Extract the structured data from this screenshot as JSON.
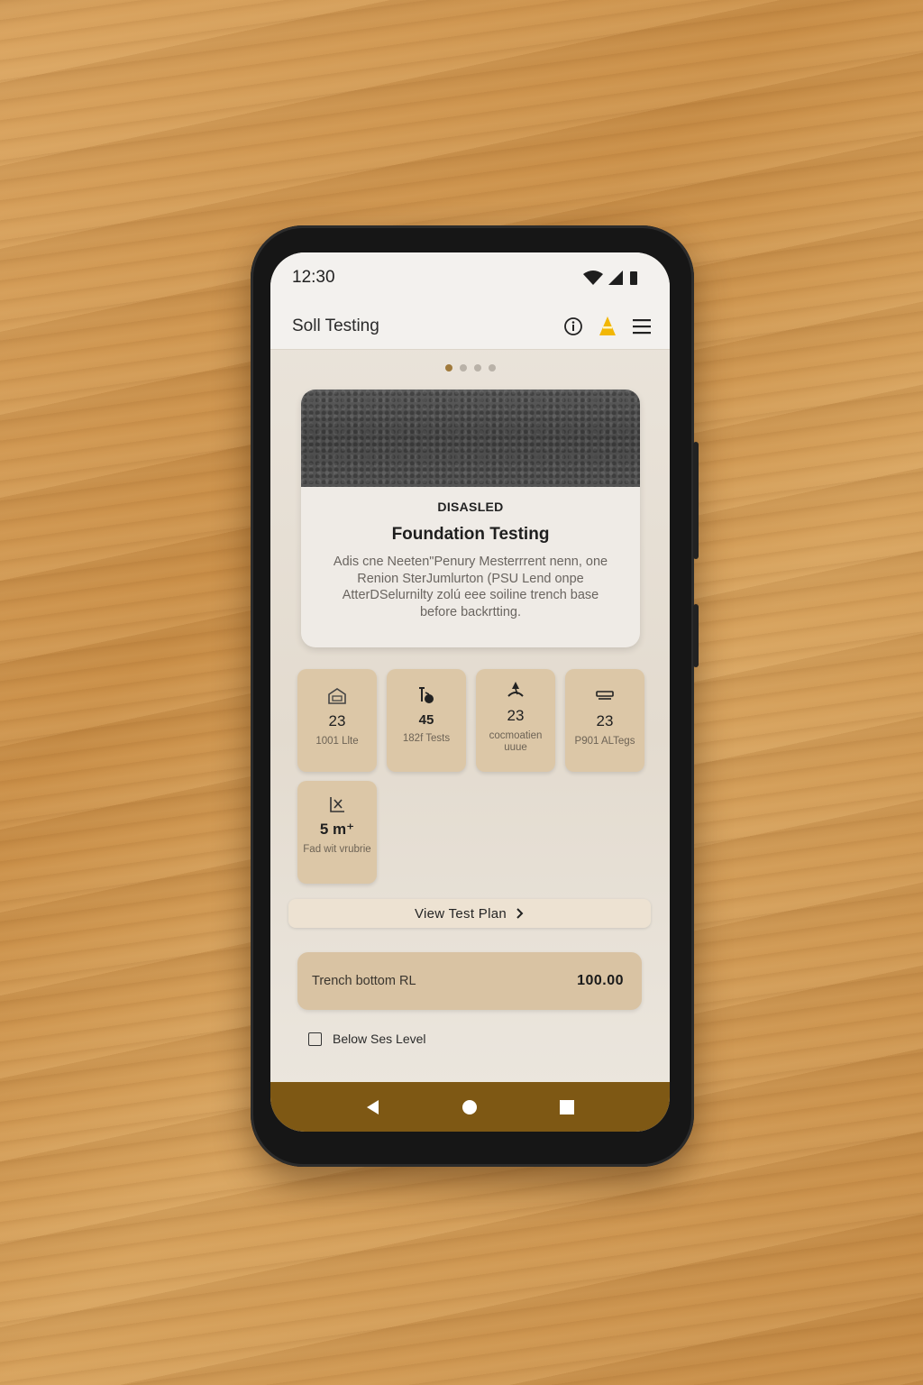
{
  "status_bar": {
    "time": "12:30"
  },
  "app_bar": {
    "title": "Soll Testing"
  },
  "carousel": {
    "page_count": 4,
    "active_index": 0
  },
  "hero": {
    "badge": "DISASLED",
    "title": "Foundation Testing",
    "description": "Adis cne Neeten\"Penury Mesterrrent nenn, one Renion  SterJumlurton (PSU Lend onpe AtterDSelurnilty zolú eee soiline trench base before backrtting."
  },
  "stats": [
    {
      "icon": "building-icon",
      "value": "23",
      "label": "1001 Llte"
    },
    {
      "icon": "probe-icon",
      "value": "45",
      "label": "182f Tests"
    },
    {
      "icon": "compaction-icon",
      "value": "23",
      "label": "cocmoatien uuue"
    },
    {
      "icon": "layers-icon",
      "value": "23",
      "label": "P901 ALTegs"
    },
    {
      "icon": "depth-icon",
      "value": "5 m⁺",
      "label": "Fad wit vrubrie"
    }
  ],
  "plan_button": {
    "label": "View Test Plan"
  },
  "rl_field": {
    "label": "Trench bottom RL",
    "value": "100.00"
  },
  "checkbox": {
    "label": "Below Ses Level",
    "checked": false
  },
  "nav": {
    "back": "back-icon",
    "home": "home-icon",
    "recents": "recents-icon"
  },
  "colors": {
    "accent": "#7e5814",
    "card": "#dcc7a7",
    "warning": "#f2b705",
    "active_dot": "#a07a3c"
  }
}
